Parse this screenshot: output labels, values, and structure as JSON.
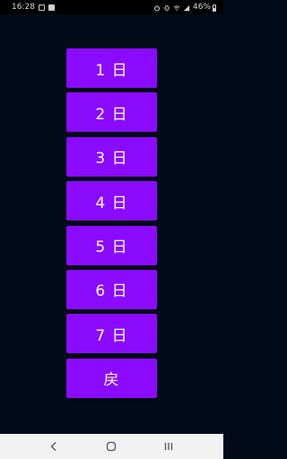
{
  "status_bar": {
    "time": "16:28",
    "battery": "46%"
  },
  "buttons": [
    {
      "label": "1 日"
    },
    {
      "label": "2 日"
    },
    {
      "label": "3 日"
    },
    {
      "label": "4 日"
    },
    {
      "label": "5 日"
    },
    {
      "label": "6 日"
    },
    {
      "label": "7 日"
    },
    {
      "label": "戻"
    }
  ],
  "colors": {
    "background": "#030a1a",
    "button": "#8a0bff",
    "button_text": "#ffffff",
    "nav_bar": "#f2f2f2"
  },
  "nav_bar": {
    "back_icon": "back-icon",
    "home_icon": "home-icon",
    "recents_icon": "recents-icon"
  }
}
